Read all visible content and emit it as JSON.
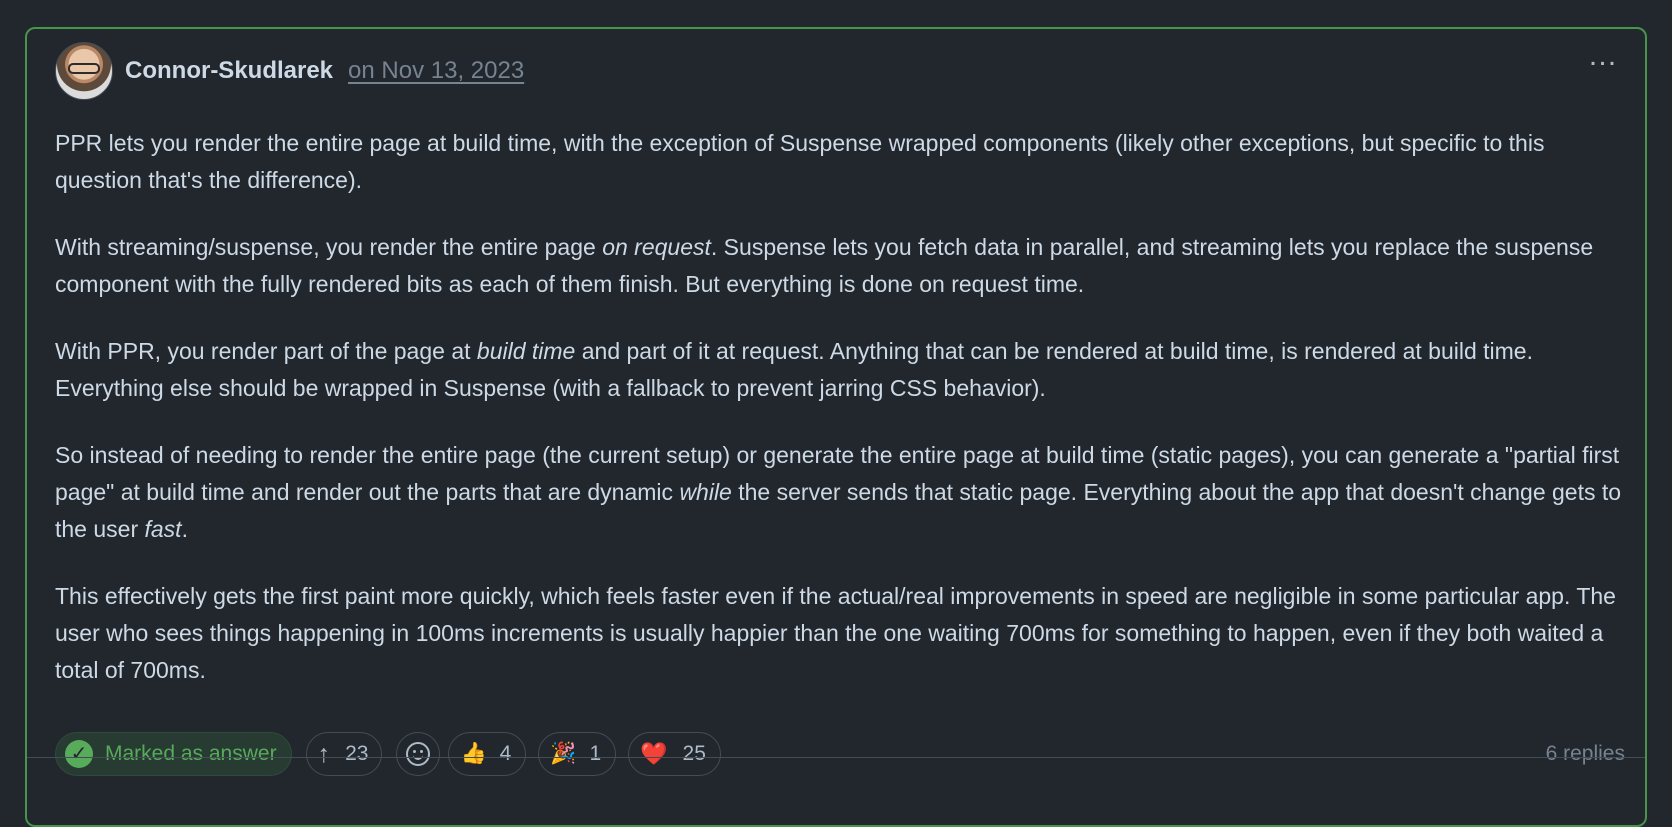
{
  "header": {
    "author": "Connor-Skudlarek",
    "date": "on Nov 13, 2023",
    "menu_icon": "more-horizontal-icon"
  },
  "content": {
    "p1": "PPR lets you render the entire page at build time, with the exception of Suspense wrapped components (likely other exceptions, but specific to this question that's the difference).",
    "p2_before": "With streaming/suspense, you render the entire page ",
    "p2_em": "on request",
    "p2_after": ". Suspense lets you fetch data in parallel, and streaming lets you replace the suspense component with the fully rendered bits as each of them finish. But everything is done on request time.",
    "p3_before": "With PPR, you render part of the page at ",
    "p3_em": "build time",
    "p3_after": " and part of it at request. Anything that can be rendered at build time, is rendered at build time. Everything else should be wrapped in Suspense (with a fallback to prevent jarring CSS behavior).",
    "p4_before": "So instead of needing to render the entire page (the current setup) or generate the entire page at build time (static pages), you can generate a \"partial first page\" at build time and render out the parts that are dynamic ",
    "p4_em1": "while",
    "p4_middle": " the server sends that static page. Everything about the app that doesn't change gets to the user ",
    "p4_em2": "fast",
    "p4_after": ".",
    "p5": "This effectively gets the first paint more quickly, which feels faster even if the actual/real improvements in speed are negligible in some particular app. The user who sees things happening in 100ms increments is usually happier than the one waiting 700ms for something to happen, even if they both waited a total of 700ms."
  },
  "footer": {
    "answer_label": "Marked as answer",
    "upvote_count": "23",
    "reactions": [
      {
        "emoji": "👍",
        "count": "4",
        "name": "thumbs-up"
      },
      {
        "emoji": "🎉",
        "count": "1",
        "name": "party"
      },
      {
        "emoji": "❤️",
        "count": "25",
        "name": "heart"
      }
    ],
    "replies": "6 replies"
  },
  "colors": {
    "background": "#22272e",
    "border_success": "#46954a",
    "success_text": "#57ab5a",
    "text_primary": "#cdd9e5",
    "text_muted": "#768390"
  }
}
